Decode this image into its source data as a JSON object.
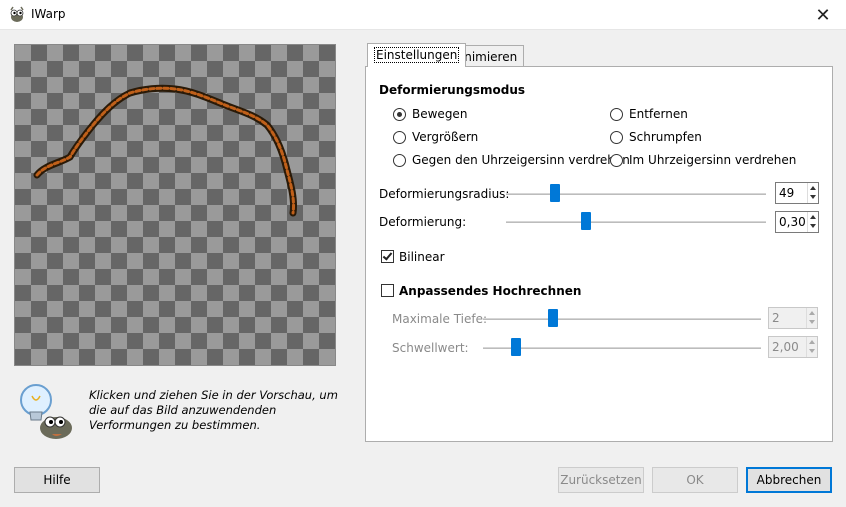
{
  "window": {
    "title": "IWarp",
    "close_glyph": "✕"
  },
  "hint": {
    "text": "Klicken und ziehen Sie in der Vorschau, um die auf das Bild anzuwendenden Verformungen zu bestimmen."
  },
  "tabs": [
    {
      "label": "Einstellungen",
      "active": true
    },
    {
      "label": "Animieren",
      "active": false
    }
  ],
  "mode": {
    "title": "Deformierungsmodus",
    "options": [
      {
        "label": "Bewegen",
        "selected": true
      },
      {
        "label": "Entfernen",
        "selected": false
      },
      {
        "label": "Vergrößern",
        "selected": false
      },
      {
        "label": "Schrumpfen",
        "selected": false
      },
      {
        "label": "Gegen den Uhrzeigersinn verdrehen",
        "selected": false
      },
      {
        "label": "Im Uhrzeigersinn verdrehen",
        "selected": false
      }
    ]
  },
  "radius": {
    "label": "Deformierungsradius:",
    "value": "49"
  },
  "amount": {
    "label": "Deformierung:",
    "value": "0,30"
  },
  "bilinear": {
    "label": "Bilinear",
    "checked": true
  },
  "supersample": {
    "label": "Anpassendes Hochrechnen",
    "checked": false,
    "max_depth": {
      "label": "Maximale Tiefe:",
      "value": "2"
    },
    "threshold": {
      "label": "Schwellwert:",
      "value": "2,00"
    }
  },
  "buttons": {
    "help": "Hilfe",
    "reset": "Zurücksetzen",
    "ok": "OK",
    "cancel": "Abbrechen"
  },
  "colors": {
    "accent": "#0078d7",
    "stroke": "#c0601a"
  },
  "icons": {
    "app": "gimp-wilber-icon",
    "hint": "lightbulb-wilber-icon"
  }
}
